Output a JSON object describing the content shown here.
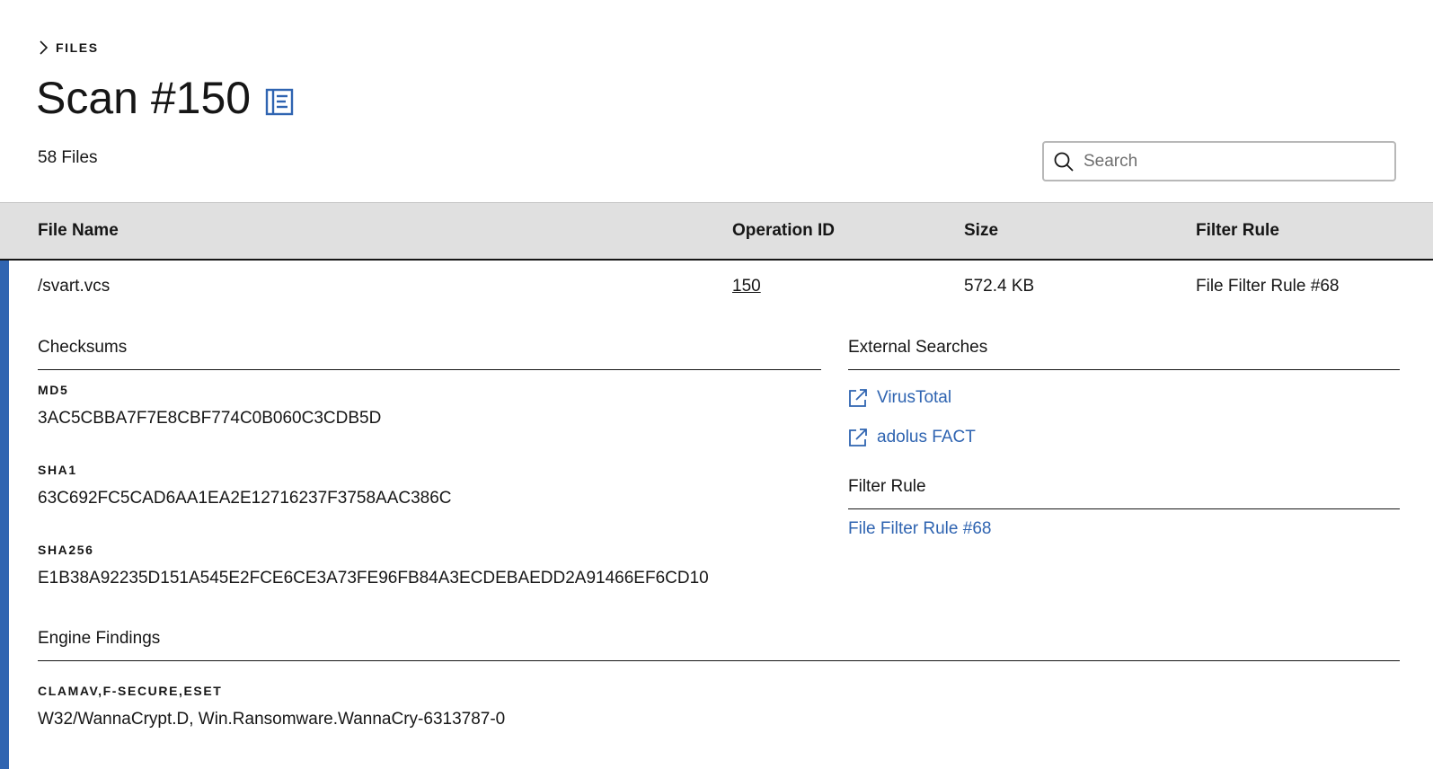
{
  "breadcrumb": {
    "label": "FILES"
  },
  "page": {
    "title": "Scan #150",
    "file_count": "58 Files"
  },
  "search": {
    "placeholder": "Search",
    "value": ""
  },
  "table": {
    "headers": [
      "File Name",
      "Operation ID",
      "Size",
      "Filter Rule"
    ],
    "rows": [
      {
        "file_name": "/svart.vcs",
        "operation_id": "150",
        "size": "572.4 KB",
        "filter_rule": "File Filter Rule #68"
      }
    ]
  },
  "details": {
    "checksums": {
      "title": "Checksums",
      "items": [
        {
          "label": "MD5",
          "value": "3AC5CBBA7F7E8CBF774C0B060C3CDB5D"
        },
        {
          "label": "SHA1",
          "value": "63C692FC5CAD6AA1EA2E12716237F3758AAC386C"
        },
        {
          "label": "SHA256",
          "value": "E1B38A92235D151A545E2FCE6CE3A73FE96FB84A3ECDEBAEDD2A91466EF6CD10"
        }
      ]
    },
    "external_searches": {
      "title": "External Searches",
      "links": [
        "VirusTotal",
        "adolus FACT"
      ]
    },
    "filter_rule": {
      "title": "Filter Rule",
      "link": "File Filter Rule #68"
    },
    "engine_findings": {
      "title": "Engine Findings",
      "engines": "CLAMAV,F-SECURE,ESET",
      "result": "W32/WannaCrypt.D, Win.Ransomware.WannaCry-6313787-0"
    }
  },
  "colors": {
    "accent": "#2f64b1",
    "header_bg": "#e0e0e0",
    "text": "#161616"
  },
  "icons": [
    "chevron-right-icon",
    "report-icon",
    "search-icon",
    "launch-icon"
  ]
}
